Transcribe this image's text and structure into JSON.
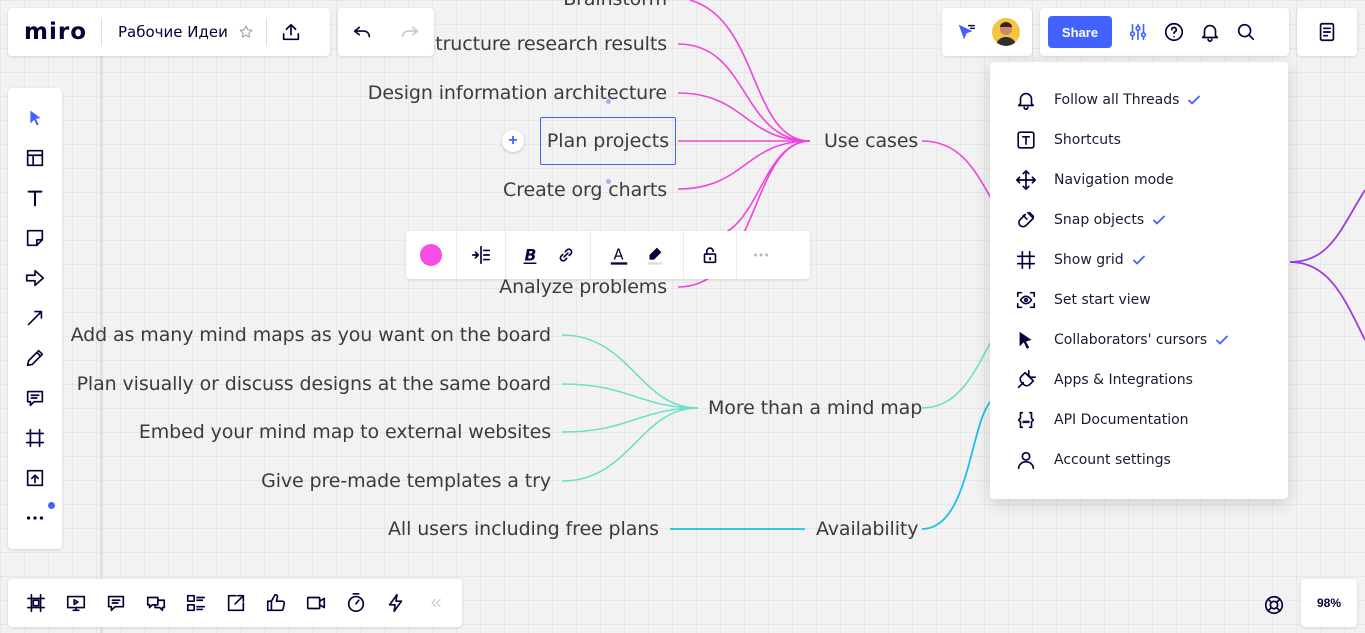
{
  "app": {
    "logo": "miro",
    "board_name": "Рабочие Идеи"
  },
  "topbar": {
    "share_label": "Share",
    "zoom": "98%"
  },
  "mindmap": {
    "pink_children": [
      "Brainstorm",
      "Structure research results",
      "Design information architecture",
      "Plan projects",
      "Create org charts",
      "Analyze problems"
    ],
    "pink_parent": "Use cases",
    "teal_children": [
      "Add as many mind maps as you want on the board",
      "Plan visually or discuss designs at the same board",
      "Embed your mind map to external websites",
      "Give pre-made templates a try"
    ],
    "teal_parent": "More than a mind map",
    "blue_child": "All users including free plans",
    "blue_parent": "Availability"
  },
  "menu": {
    "items": [
      {
        "label": "Follow all Threads",
        "icon": "bell-icon",
        "checked": true
      },
      {
        "label": "Shortcuts",
        "icon": "shortcut-key-icon",
        "checked": false
      },
      {
        "label": "Navigation mode",
        "icon": "move-arrows-icon",
        "checked": false
      },
      {
        "label": "Snap objects",
        "icon": "magnet-icon",
        "checked": true
      },
      {
        "label": "Show grid",
        "icon": "grid-icon",
        "checked": true
      },
      {
        "label": "Set start view",
        "icon": "eye-frame-icon",
        "checked": false
      },
      {
        "label": "Collaborators' cursors",
        "icon": "cursor-icon",
        "checked": true
      },
      {
        "label": "Apps & Integrations",
        "icon": "plug-icon",
        "checked": false
      },
      {
        "label": "API Documentation",
        "icon": "braces-icon",
        "checked": false
      },
      {
        "label": "Account settings",
        "icon": "user-icon",
        "checked": false
      }
    ]
  },
  "colors": {
    "accent": "#4262ff",
    "pink": "#ee44dd",
    "teal": "#6fe0c8",
    "blue": "#1cc0ea",
    "purple": "#9b3fe0",
    "selected_color": "#f74de5"
  }
}
